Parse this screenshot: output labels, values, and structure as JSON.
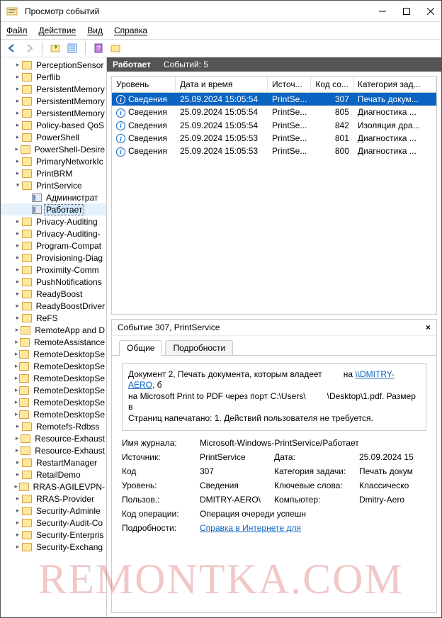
{
  "window": {
    "title": "Просмотр событий"
  },
  "menu": {
    "file": "Файл",
    "action": "Действие",
    "view": "Вид",
    "help": "Справка"
  },
  "tree": {
    "items": [
      "PerceptionSensor",
      "Perflib",
      "PersistentMemory",
      "PersistentMemory",
      "PersistentMemory",
      "Policy-based QoS",
      "PowerShell",
      "PowerShell-Desire",
      "PrimaryNetworkIc",
      "PrintBRM"
    ],
    "expanded_label": "PrintService",
    "children": [
      "Администрат",
      "Работает"
    ],
    "items2": [
      "Privacy-Auditing",
      "Privacy-Auditing-",
      "Program-Compat",
      "Provisioning-Diag",
      "Proximity-Comm",
      "PushNotifications",
      "ReadyBoost",
      "ReadyBoostDriver",
      "ReFS",
      "RemoteApp and D",
      "RemoteAssistance",
      "RemoteDesktopSe",
      "RemoteDesktopSe",
      "RemoteDesktopSe",
      "RemoteDesktopSe",
      "RemoteDesktopSe",
      "RemoteDesktopSe",
      "Remotefs-Rdbss",
      "Resource-Exhaust",
      "Resource-Exhaust",
      "RestartManager",
      "RetailDemo",
      "RRAS-AGILEVPN-",
      "RRAS-Provider",
      "Security-Adminle",
      "Security-Audit-Co",
      "Security-Enterpris",
      "Security-Exchang"
    ]
  },
  "status": {
    "label": "Работает",
    "count": "Событий: 5"
  },
  "cols": {
    "level": "Уровень",
    "datetime": "Дата и время",
    "source": "Источ...",
    "code": "Код со...",
    "category": "Категория зад..."
  },
  "events": [
    {
      "level": "Сведения",
      "dt": "25.09.2024 15:05:54",
      "src": "PrintSe...",
      "code": "307",
      "cat": "Печать докум..."
    },
    {
      "level": "Сведения",
      "dt": "25.09.2024 15:05:54",
      "src": "PrintSe...",
      "code": "805",
      "cat": "Диагностика ..."
    },
    {
      "level": "Сведения",
      "dt": "25.09.2024 15:05:54",
      "src": "PrintSe...",
      "code": "842",
      "cat": "Изоляция дра..."
    },
    {
      "level": "Сведения",
      "dt": "25.09.2024 15:05:53",
      "src": "PrintSe...",
      "code": "801",
      "cat": "Диагностика ..."
    },
    {
      "level": "Сведения",
      "dt": "25.09.2024 15:05:53",
      "src": "PrintSe...",
      "code": "800",
      "cat": "Диагностика ..."
    }
  ],
  "detail": {
    "title": "Событие 307, PrintService",
    "tabs": {
      "general": "Общие",
      "details": "Подробности"
    },
    "desc_p1": "Документ 2, Печать документа, которым владеет",
    "desc_on": "на",
    "desc_link": "\\\\DMITRY-AERO",
    "desc_p2": "на Microsoft Print to PDF через порт C:\\Users\\",
    "desc_p3": "\\Desktop\\1.pdf.  Размер в",
    "desc_p4": "Страниц напечатано: 1. Действий пользователя не требуется.",
    "props": {
      "journal_l": "Имя журнала:",
      "journal_v": "Microsoft-Windows-PrintService/Работает",
      "source_l": "Источник:",
      "source_v": "PrintService",
      "date_l": "Дата:",
      "date_v": "25.09.2024 15",
      "code_l": "Код",
      "code_v": "307",
      "cat_l": "Категория задачи:",
      "cat_v": "Печать докум",
      "level_l": "Уровень:",
      "level_v": "Сведения",
      "kw_l": "Ключевые слова:",
      "kw_v": "Классическо",
      "user_l": "Пользов.:",
      "user_v": "DMITRY-AERO\\",
      "comp_l": "Компьютер:",
      "comp_v": "Dmitry-Aero",
      "op_l": "Код операции:",
      "op_v": "Операция очереди успешн",
      "more_l": "Подробности:",
      "more_link": "Справка в Интернете для"
    }
  },
  "watermark": "REMONTKA.COM"
}
